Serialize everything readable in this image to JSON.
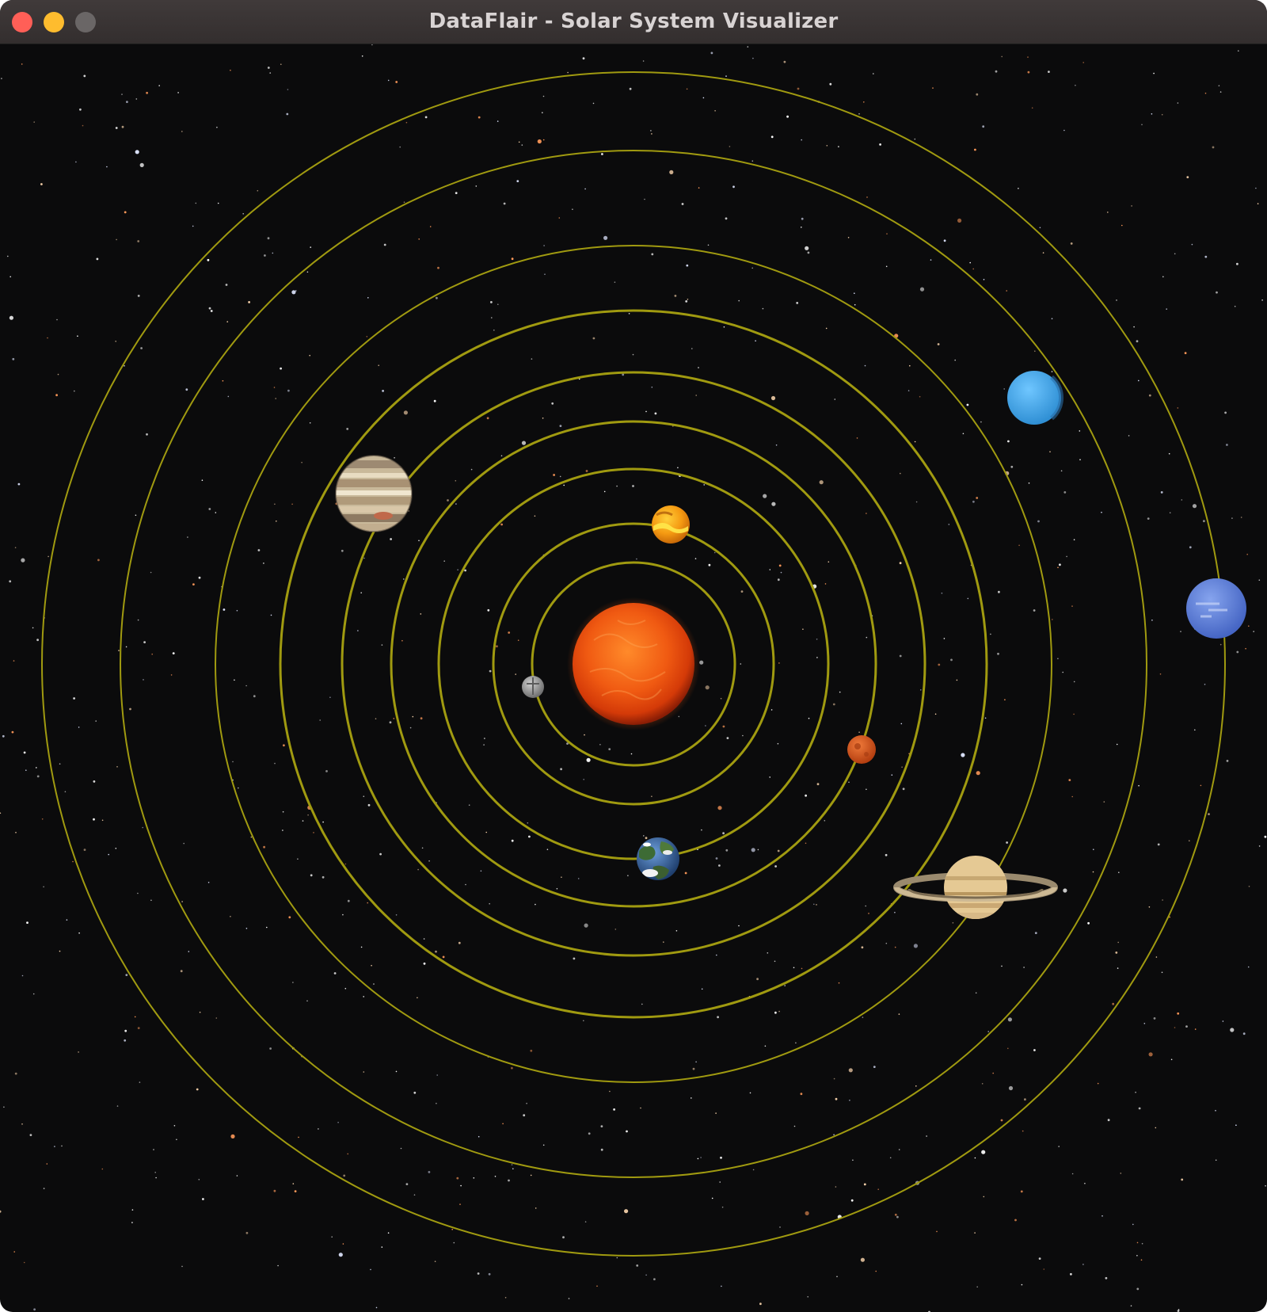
{
  "window": {
    "title": "DataFlair - Solar System Visualizer",
    "buttons": [
      "close",
      "minimize",
      "zoom"
    ]
  },
  "scene": {
    "background": "#0b0b0c",
    "orbit_color": "#a09a10",
    "sun": {
      "icon": "sun-icon",
      "color": "#e8500f"
    },
    "planets": [
      {
        "name": "Mercury",
        "icon": "mercury-icon",
        "color": "#9a9a9a"
      },
      {
        "name": "Venus",
        "icon": "venus-icon",
        "color": "#f2a21a"
      },
      {
        "name": "Earth",
        "icon": "earth-icon",
        "color": "#3a6aa8"
      },
      {
        "name": "Mars",
        "icon": "mars-icon",
        "color": "#d4551e"
      },
      {
        "name": "Jupiter",
        "icon": "jupiter-icon",
        "color": "#c9b99a"
      },
      {
        "name": "Saturn",
        "icon": "saturn-icon",
        "color": "#e2c48e"
      },
      {
        "name": "Uranus",
        "icon": "uranus-icon",
        "color": "#4fb3f2"
      },
      {
        "name": "Neptune",
        "icon": "neptune-icon",
        "color": "#5f86de"
      }
    ]
  }
}
